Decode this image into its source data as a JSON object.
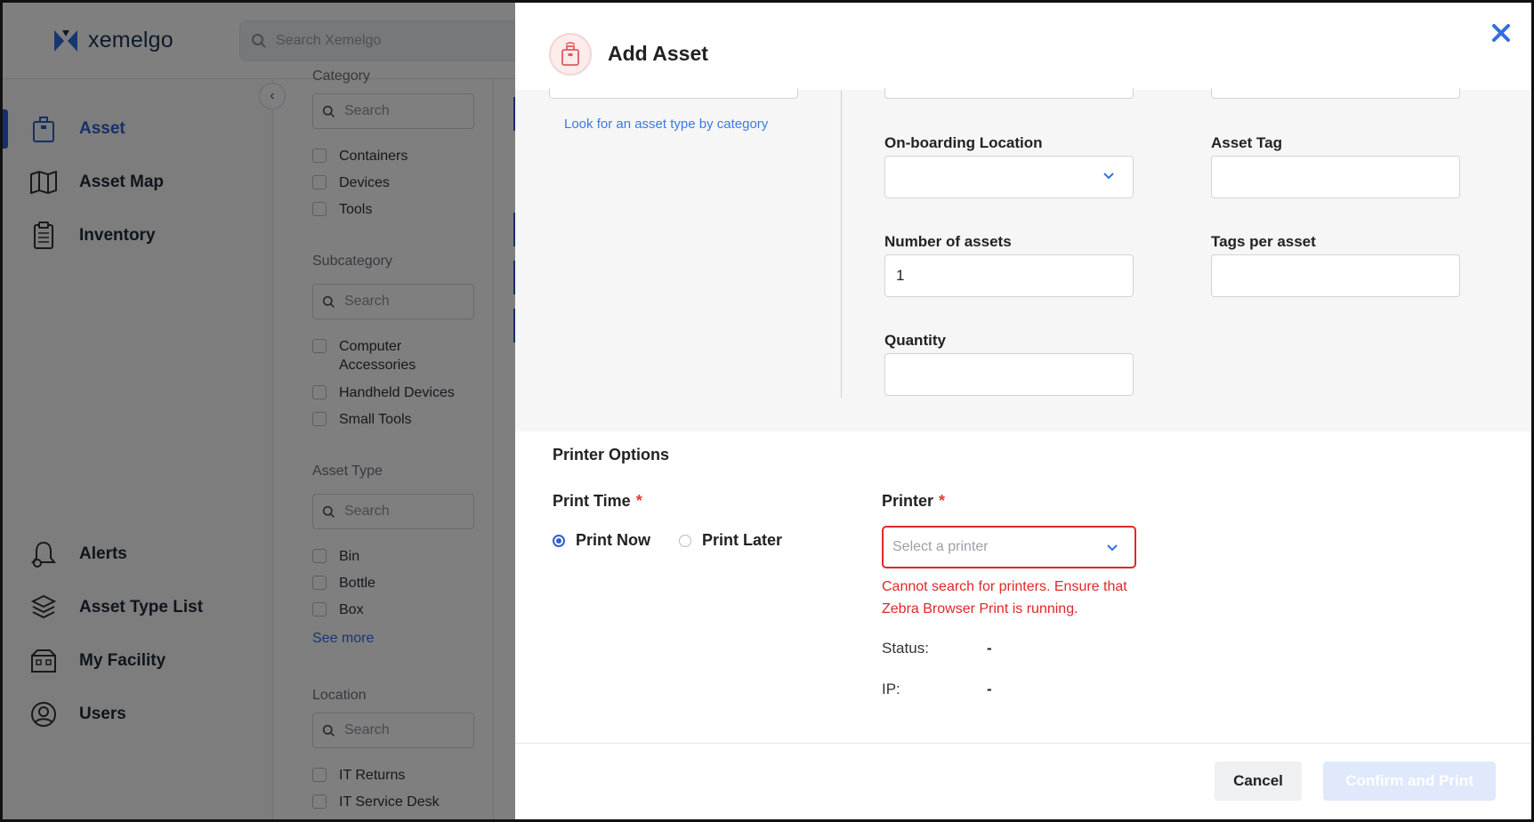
{
  "app": {
    "brand": "xemelgo",
    "search_placeholder": "Search Xemelgo",
    "accent_color": "#2f5fd0"
  },
  "sidebar": {
    "items": [
      {
        "label": "Asset",
        "icon": "asset-icon",
        "active": true
      },
      {
        "label": "Asset Map",
        "icon": "map-icon"
      },
      {
        "label": "Inventory",
        "icon": "clipboard-icon"
      },
      {
        "label": "Alerts",
        "icon": "bell-icon"
      },
      {
        "label": "Asset Type List",
        "icon": "asset-type-list-icon"
      },
      {
        "label": "My Facility",
        "icon": "facility-icon"
      },
      {
        "label": "Users",
        "icon": "user-icon"
      }
    ]
  },
  "filters": {
    "category_title": "Category",
    "category_search": "Search",
    "category_options": [
      "Containers",
      "Devices",
      "Tools"
    ],
    "subcategory_title": "Subcategory",
    "subcategory_search": "Search",
    "subcategory_options": [
      "Computer Accessories",
      "Handheld Devices",
      "Small Tools"
    ],
    "asset_type_title": "Asset Type",
    "asset_type_search": "Search",
    "asset_type_options": [
      "Bin",
      "Bottle",
      "Box"
    ],
    "see_more": "See more",
    "location_title": "Location",
    "location_search": "Search",
    "location_options": [
      "IT Returns",
      "IT Service Desk"
    ]
  },
  "modal": {
    "title": "Add Asset",
    "type_link": "Look for an asset type by category",
    "fields": {
      "onboarding_location": {
        "label": "On-boarding Location",
        "value": ""
      },
      "asset_tag": {
        "label": "Asset Tag",
        "value": ""
      },
      "number_of_assets": {
        "label": "Number of assets",
        "value": "1"
      },
      "tags_per_asset": {
        "label": "Tags per asset",
        "value": ""
      },
      "quantity": {
        "label": "Quantity",
        "value": ""
      }
    },
    "printer_options": {
      "title": "Printer Options",
      "print_time_label": "Print Time",
      "required_mark": "*",
      "print_now": "Print Now",
      "print_later": "Print Later",
      "selected": "Print Now",
      "printer_label": "Printer",
      "printer_placeholder": "Select a printer",
      "error": "Cannot search for printers. Ensure that Zebra Browser Print is running.",
      "status_label": "Status:",
      "status_value": "-",
      "ip_label": "IP:",
      "ip_value": "-",
      "error_color": "#e02828"
    },
    "buttons": {
      "cancel": "Cancel",
      "confirm": "Confirm and Print"
    }
  }
}
